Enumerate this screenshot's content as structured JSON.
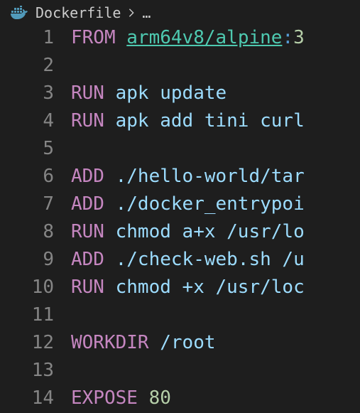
{
  "breadcrumb": {
    "filename": "Dockerfile",
    "ellipsis": "…"
  },
  "lines": [
    {
      "n": "1",
      "tokens": [
        {
          "t": "FROM",
          "c": "kw"
        },
        {
          "t": " ",
          "c": "plain"
        },
        {
          "t": "arm64v8/alpine",
          "c": "link"
        },
        {
          "t": ":",
          "c": "op"
        },
        {
          "t": "3",
          "c": "num"
        }
      ]
    },
    {
      "n": "2",
      "tokens": []
    },
    {
      "n": "3",
      "tokens": [
        {
          "t": "RUN",
          "c": "kw"
        },
        {
          "t": " ",
          "c": "plain"
        },
        {
          "t": "apk update",
          "c": "arg"
        }
      ]
    },
    {
      "n": "4",
      "tokens": [
        {
          "t": "RUN",
          "c": "kw"
        },
        {
          "t": " ",
          "c": "plain"
        },
        {
          "t": "apk add tini curl",
          "c": "arg"
        }
      ]
    },
    {
      "n": "5",
      "tokens": []
    },
    {
      "n": "6",
      "tokens": [
        {
          "t": "ADD",
          "c": "kw"
        },
        {
          "t": " ",
          "c": "plain"
        },
        {
          "t": "./hello-world/tar",
          "c": "arg"
        }
      ]
    },
    {
      "n": "7",
      "tokens": [
        {
          "t": "ADD",
          "c": "kw"
        },
        {
          "t": " ",
          "c": "plain"
        },
        {
          "t": "./docker_entrypoi",
          "c": "arg"
        }
      ]
    },
    {
      "n": "8",
      "tokens": [
        {
          "t": "RUN",
          "c": "kw"
        },
        {
          "t": " ",
          "c": "plain"
        },
        {
          "t": "chmod a+x /usr/lo",
          "c": "arg"
        }
      ]
    },
    {
      "n": "9",
      "tokens": [
        {
          "t": "ADD",
          "c": "kw"
        },
        {
          "t": " ",
          "c": "plain"
        },
        {
          "t": "./check-web.sh /u",
          "c": "arg"
        }
      ]
    },
    {
      "n": "10",
      "tokens": [
        {
          "t": "RUN",
          "c": "kw"
        },
        {
          "t": " ",
          "c": "plain"
        },
        {
          "t": "chmod +x /usr/loc",
          "c": "arg"
        }
      ]
    },
    {
      "n": "11",
      "tokens": []
    },
    {
      "n": "12",
      "tokens": [
        {
          "t": "WORKDIR",
          "c": "kw"
        },
        {
          "t": " ",
          "c": "plain"
        },
        {
          "t": "/root",
          "c": "arg"
        }
      ]
    },
    {
      "n": "13",
      "tokens": []
    },
    {
      "n": "14",
      "tokens": [
        {
          "t": "EXPOSE",
          "c": "kw"
        },
        {
          "t": " ",
          "c": "plain"
        },
        {
          "t": "80",
          "c": "num"
        }
      ]
    }
  ]
}
